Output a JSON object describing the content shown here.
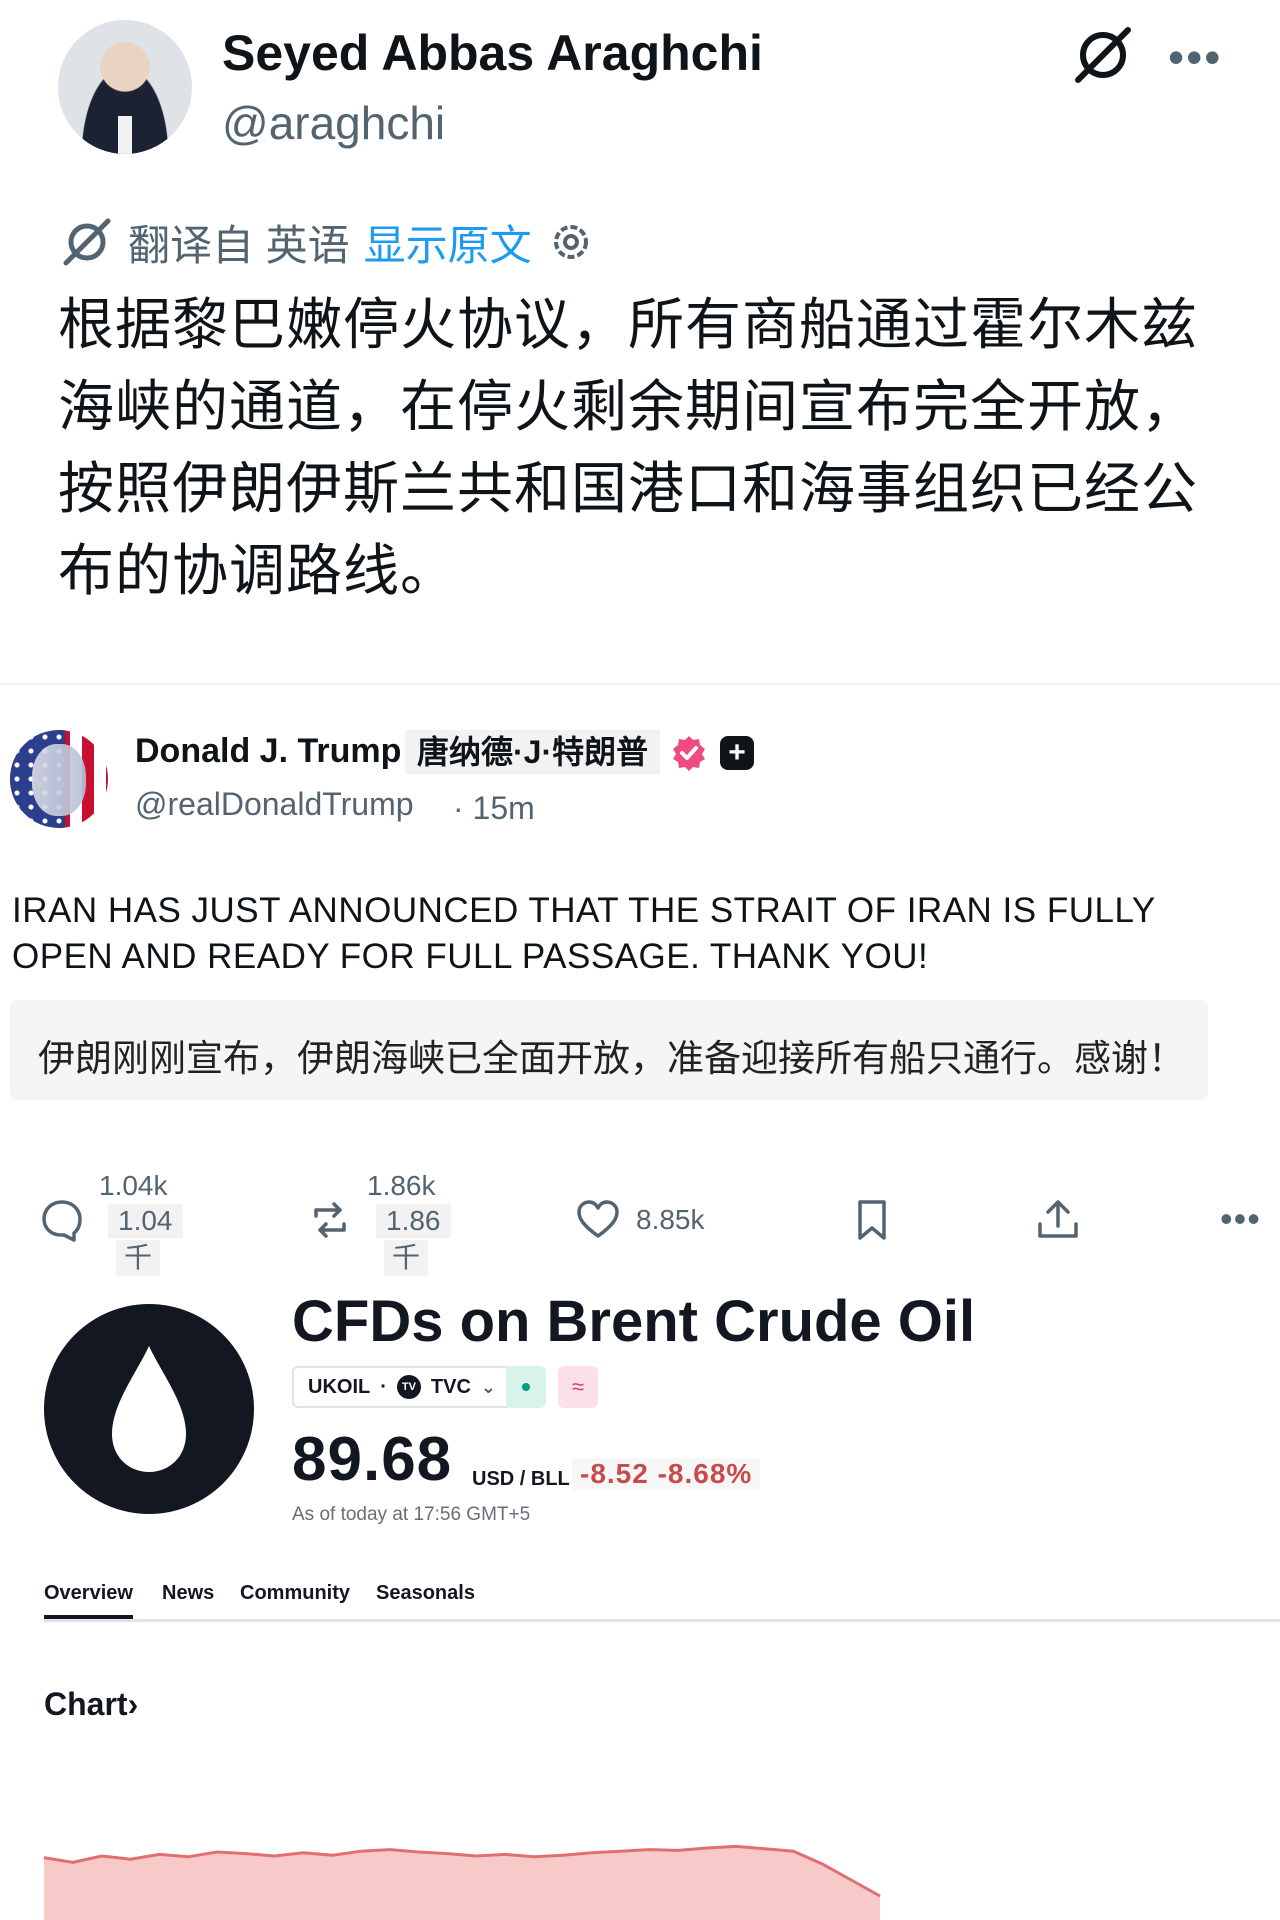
{
  "post1": {
    "name": "Seyed Abbas Araghchi",
    "handle": "@araghchi",
    "translated_from": "翻译自 英语",
    "show_original": "显示原文",
    "body": "根据黎巴嫩停火协议，所有商船通过霍尔木兹海峡的通道，在停火剩余期间宣布完全开放，按照伊朗伊斯兰共和国港口和海事组织已经公布的协调路线。"
  },
  "post2": {
    "name": "Donald J. Trump",
    "name_cn": "唐纳德·J·特朗普",
    "handle": "@realDonaldTrump",
    "time": "· 15m",
    "body": "IRAN HAS JUST ANNOUNCED THAT THE STRAIT OF IRAN IS FULLY OPEN AND READY FOR FULL PASSAGE. THANK YOU!",
    "translation": "伊朗刚刚宣布，伊朗海峡已全面开放，准备迎接所有船只通行。感谢！",
    "actions": {
      "replies_top": "1.04k",
      "replies_chip": "1.04",
      "replies_unit": "千",
      "reposts_top": "1.86k",
      "reposts_chip": "1.86",
      "reposts_unit": "千",
      "likes": "8.85k"
    }
  },
  "quote": {
    "title": "CFDs on Brent Crude Oil",
    "symbol": "UKOIL",
    "exchange": "TVC",
    "tv_badge": "TV",
    "approx": "≈",
    "price": "89.68",
    "unit": "USD / BLL",
    "change": "-8.52 -8.68%",
    "as_of": "As of today at 17:56 GMT+5",
    "tabs": [
      "Overview",
      "News",
      "Community",
      "Seasonals"
    ],
    "chart_label": "Chart›",
    "colors": {
      "down": "#c94a4a",
      "up_dot": "#089981",
      "chart_fill": "#f7c9c9",
      "chart_line": "#e07070"
    },
    "mini_chart": {
      "values": [
        78,
        72,
        80,
        76,
        82,
        79,
        85,
        83,
        80,
        84,
        81,
        86,
        88,
        85,
        83,
        80,
        82,
        79,
        81,
        84,
        86,
        88,
        87,
        90,
        92,
        89,
        86,
        70,
        50,
        30
      ]
    }
  },
  "icons": {
    "grok": "grok-icon",
    "more": "more-icon",
    "gear": "gear-icon",
    "verified": "verified-badge-icon",
    "reply": "reply-icon",
    "repost": "repost-icon",
    "like": "heart-icon",
    "bookmark": "bookmark-icon",
    "share": "share-icon"
  }
}
